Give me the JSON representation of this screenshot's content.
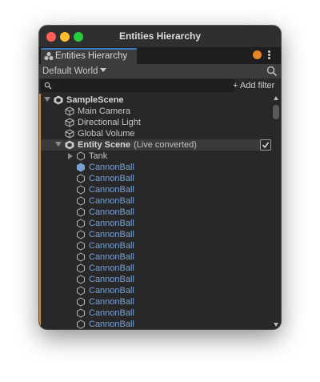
{
  "window": {
    "title": "Entities Hierarchy"
  },
  "tab": {
    "label": "Entities Hierarchy",
    "icon": "entities-icon"
  },
  "toolbar": {
    "world": "Default World",
    "search_icon": "search-icon"
  },
  "filter": {
    "search_placeholder": "",
    "add_filter": "+ Add filter"
  },
  "status_colors": {
    "live_conversion": "#d98a1f",
    "entity_text": "#7aa0d2",
    "tab_accent": "#3a79bb",
    "pending_dot": "#e8862a"
  },
  "hierarchy": {
    "scene": "SampleScene",
    "scene_children": [
      "Main Camera",
      "Directional Light",
      "Global Volume"
    ],
    "subscene": {
      "name": "Entity Scene",
      "status": "(Live converted)",
      "checked": true
    },
    "subscene_children": {
      "parent": "Tank",
      "entities": [
        "CannonBall",
        "CannonBall",
        "CannonBall",
        "CannonBall",
        "CannonBall",
        "CannonBall",
        "CannonBall",
        "CannonBall",
        "CannonBall",
        "CannonBall",
        "CannonBall",
        "CannonBall",
        "CannonBall",
        "CannonBall",
        "CannonBall"
      ]
    }
  }
}
